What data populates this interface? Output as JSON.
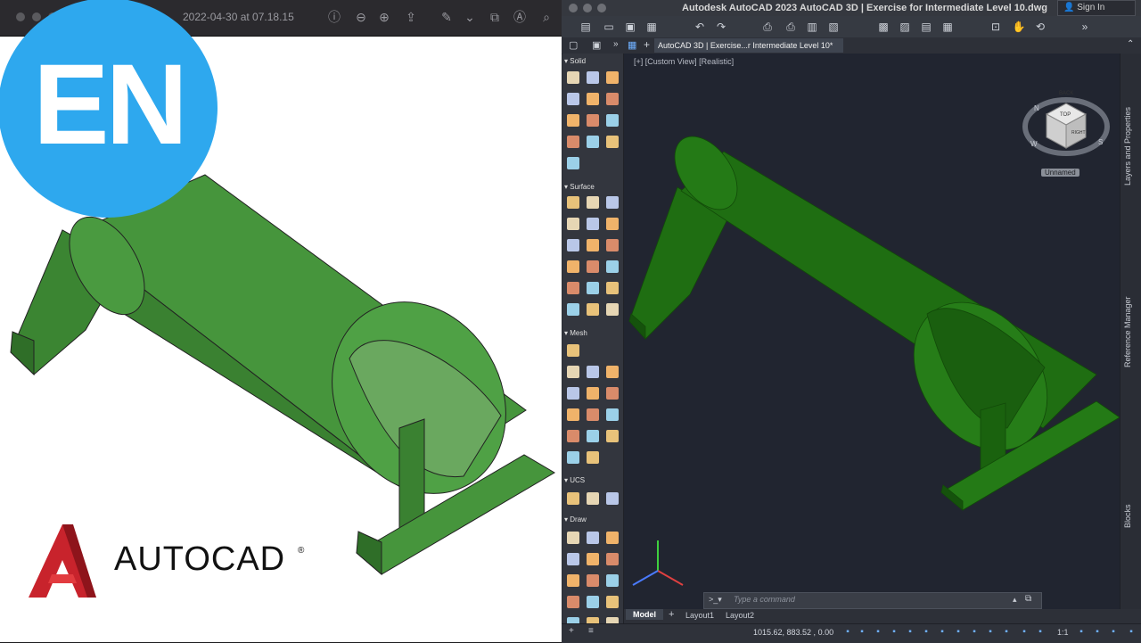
{
  "preview": {
    "title": "2022-04-30 at 07.18.15",
    "badge": "EN",
    "brand_name": "AUTOCAD",
    "brand_reg": "®"
  },
  "acad": {
    "window_title": "Autodesk AutoCAD 2023    AutoCAD 3D | Exercise for Intermediate Level 10.dwg",
    "sign_in": "Sign In",
    "doc_tab": "AutoCAD 3D | Exercise...r Intermediate Level 10*",
    "viewport_label": "[+] [Custom View] [Realistic]",
    "viewcube": {
      "top": "TOP",
      "back": "BACK",
      "right": "RIGHT",
      "n": "N",
      "w": "W",
      "s": "S",
      "ucs": "Unnamed"
    },
    "palette_sections": [
      "Solid",
      "Surface",
      "Mesh",
      "UCS",
      "Draw"
    ],
    "side_panels": [
      "Layers and Properties",
      "Reference Manager",
      "Blocks"
    ],
    "command_placeholder": "Type a command",
    "layout_tabs": [
      "Model",
      "Layout1",
      "Layout2"
    ],
    "coordinates": "1015.62, 883.52 , 0.00",
    "scale": "1:1"
  },
  "colors": {
    "badge": "#2ea8ee",
    "solid_green": "#3f8a36",
    "acad_green": "#1e6b10",
    "viewport_bg": "#212530"
  }
}
